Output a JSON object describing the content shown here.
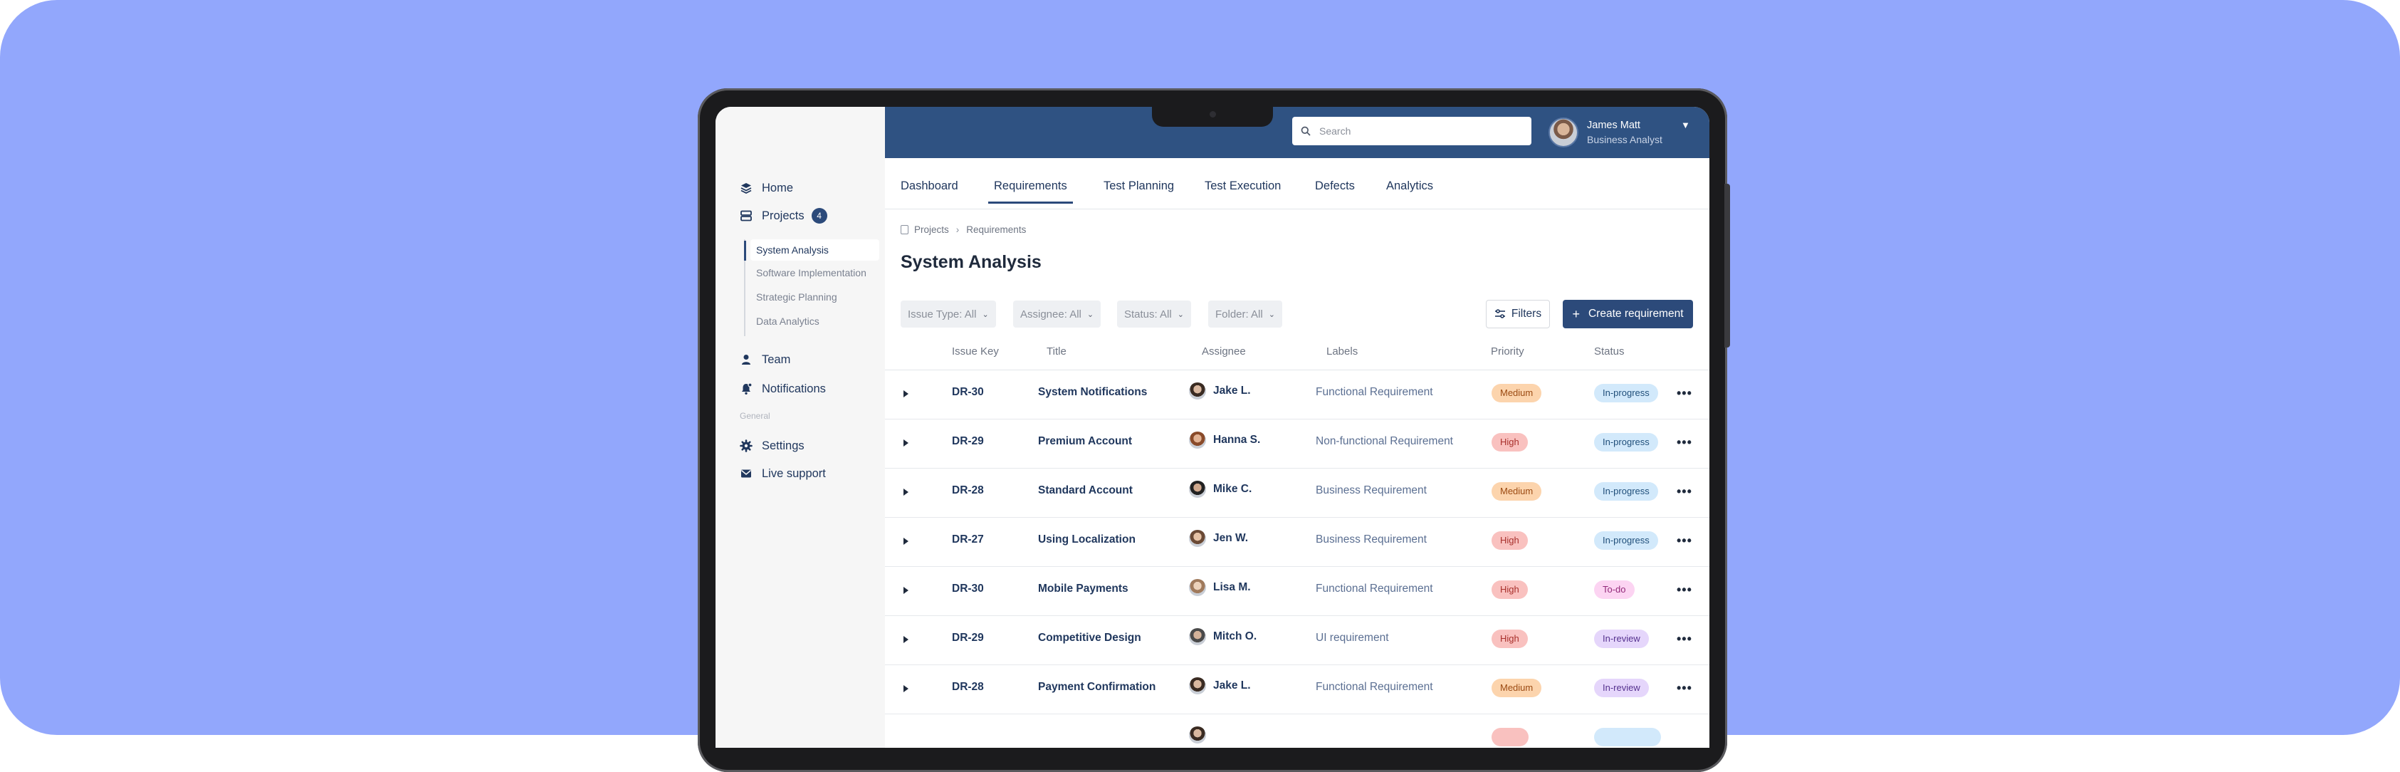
{
  "colors": {
    "background": "#92a7fc",
    "header": "#2f5282",
    "accent": "#2c4a7a",
    "priority_medium": "#fcd4ad",
    "priority_high": "#f9c1bf",
    "status_in_progress": "#d2e9fb",
    "status_todo": "#fcd4f2",
    "status_in_review": "#e5d6fb"
  },
  "sidebar": {
    "home": {
      "label": "Home",
      "icon": "layers-icon"
    },
    "projects": {
      "label": "Projects",
      "icon": "server-icon",
      "badge": "4"
    },
    "subitems": [
      "System Analysis",
      "Software Implementation",
      "Strategic Planning",
      "Data Analytics"
    ],
    "team": {
      "label": "Team",
      "icon": "person-icon"
    },
    "notifications": {
      "label": "Notifications",
      "icon": "bell-icon"
    },
    "section_label": "General",
    "settings": {
      "label": "Settings",
      "icon": "gear-icon"
    },
    "live_support": {
      "label": "Live support",
      "icon": "mail-icon"
    }
  },
  "header": {
    "search_placeholder": "Search",
    "user_name": "James Matt",
    "user_role": "Business Analyst"
  },
  "tabs": [
    "Dashboard",
    "Requirements",
    "Test Planning",
    "Test Execution",
    "Defects",
    "Analytics"
  ],
  "active_tab": "Requirements",
  "breadcrumb": [
    "Projects",
    "Requirements"
  ],
  "page_title": "System Analysis",
  "filters": [
    "Issue Type: All",
    "Assignee: All",
    "Status: All",
    "Folder: All"
  ],
  "buttons": {
    "filters": "Filters",
    "create": "Create requirement"
  },
  "table": {
    "columns": [
      "Issue Key",
      "Title",
      "Assignee",
      "Labels",
      "Priority",
      "Status"
    ],
    "rows": [
      {
        "key": "DR-30",
        "title": "System Notifications",
        "assignee": "Jake L.",
        "label": "Functional Requirement",
        "priority": "Medium",
        "status": "In-progress"
      },
      {
        "key": "DR-29",
        "title": "Premium Account",
        "assignee": "Hanna S.",
        "label": "Non-functional Requirement",
        "priority": "High",
        "status": "In-progress"
      },
      {
        "key": "DR-28",
        "title": "Standard Account",
        "assignee": "Mike C.",
        "label": "Business Requirement",
        "priority": "Medium",
        "status": "In-progress"
      },
      {
        "key": "DR-27",
        "title": "Using Localization",
        "assignee": "Jen W.",
        "label": "Business Requirement",
        "priority": "High",
        "status": "In-progress"
      },
      {
        "key": "DR-30",
        "title": "Mobile Payments",
        "assignee": "Lisa M.",
        "label": "Functional Requirement",
        "priority": "High",
        "status": "To-do"
      },
      {
        "key": "DR-29",
        "title": "Competitive Design",
        "assignee": "Mitch O.",
        "label": "UI requirement",
        "priority": "High",
        "status": "In-review"
      },
      {
        "key": "DR-28",
        "title": "Payment Confirmation",
        "assignee": "Jake L.",
        "label": "Functional Requirement",
        "priority": "Medium",
        "status": "In-review"
      }
    ]
  }
}
